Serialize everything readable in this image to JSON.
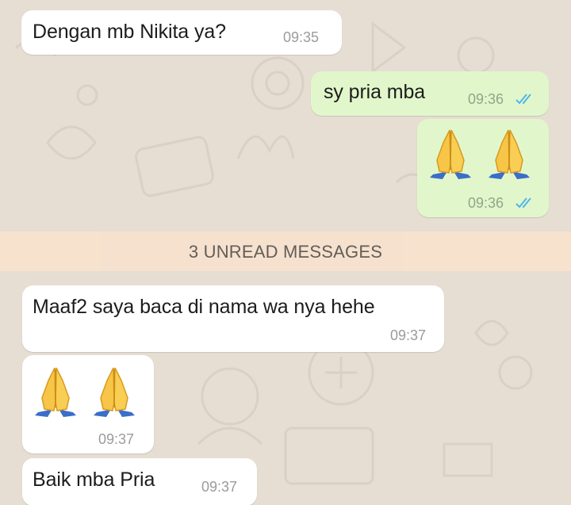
{
  "colors": {
    "background": "#e6ddd3",
    "incoming_bubble": "#ffffff",
    "outgoing_bubble": "#e1f7cb",
    "unread_banner": "#f7e2ce",
    "read_ticks": "#4fb6ec",
    "timestamp": "#9b9b9b"
  },
  "messages": [
    {
      "direction": "incoming",
      "text": "Dengan mb Nikita ya?",
      "time": "09:35"
    },
    {
      "direction": "outgoing",
      "text": "sy pria mba",
      "time": "09:36",
      "status": "read",
      "status_icon": "double-check-icon"
    },
    {
      "direction": "outgoing",
      "emoji": "folded-hands-icon x2",
      "time": "09:36",
      "status": "read",
      "status_icon": "double-check-icon"
    },
    {
      "direction": "incoming",
      "text": "Maaf2 saya baca di nama wa nya hehe",
      "time": "09:37"
    },
    {
      "direction": "incoming",
      "emoji": "folded-hands-icon x2",
      "time": "09:37"
    },
    {
      "direction": "incoming",
      "text": "Baik mba Pria",
      "time": "09:37"
    }
  ],
  "unread_banner": {
    "label": "3 UNREAD MESSAGES"
  }
}
